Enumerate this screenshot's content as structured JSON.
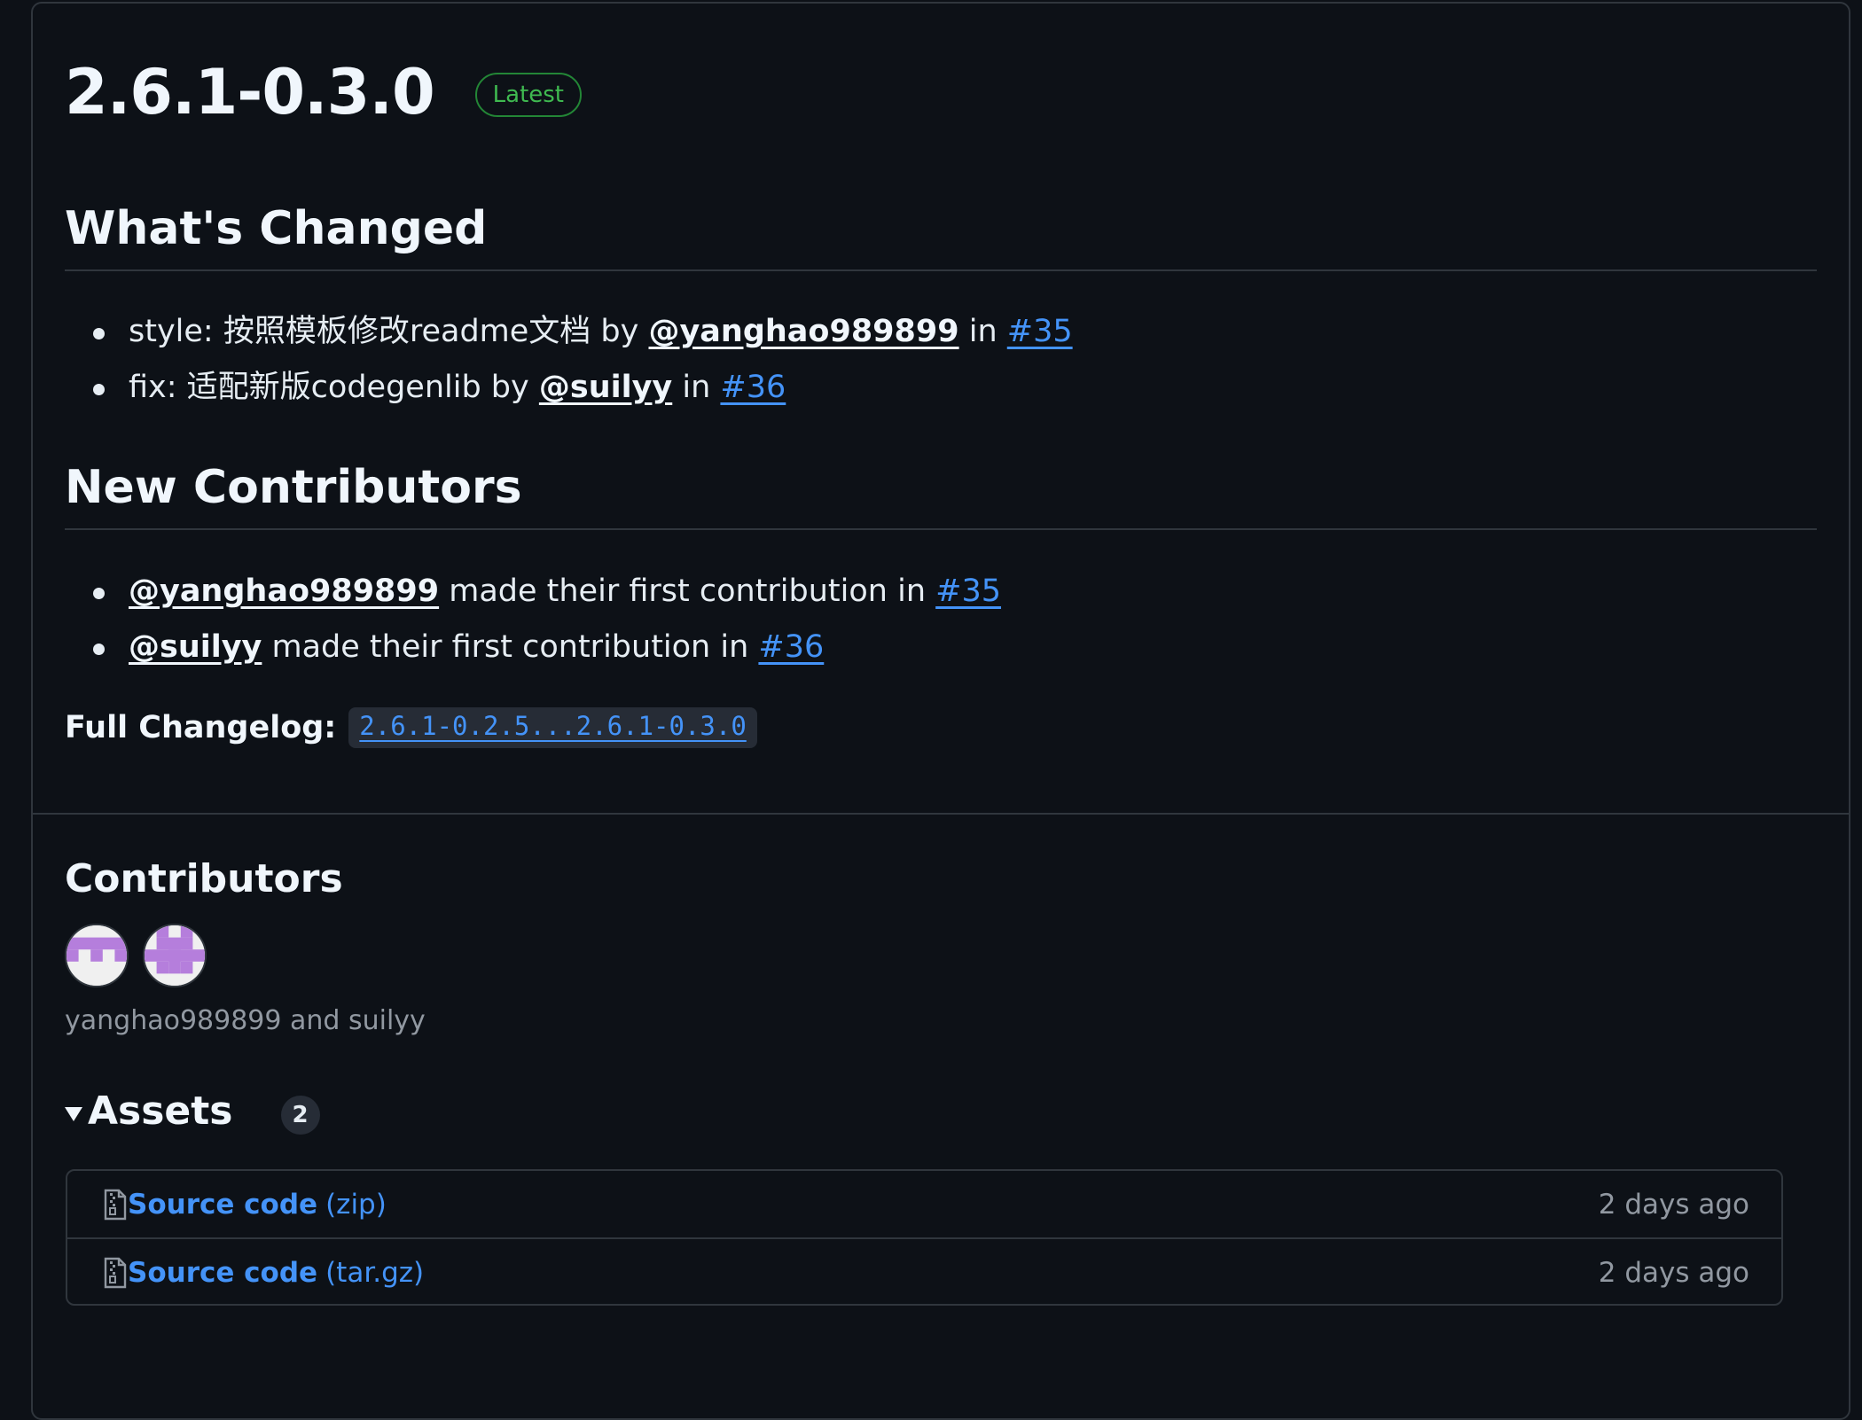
{
  "release": {
    "title": "2.6.1-0.3.0",
    "badge": "Latest"
  },
  "whats_changed": {
    "heading": "What's Changed",
    "items": [
      {
        "text": "style: 按照模板修改readme文档 by ",
        "author": "@yanghao989899",
        "in": " in ",
        "pr": "#35"
      },
      {
        "text": "fix: 适配新版codegenlib by ",
        "author": "@suilyy",
        "in": " in ",
        "pr": "#36"
      }
    ]
  },
  "new_contributors": {
    "heading": "New Contributors",
    "items": [
      {
        "author": "@yanghao989899",
        "text": " made their first contribution in ",
        "pr": "#35"
      },
      {
        "author": "@suilyy",
        "text": " made their first contribution in ",
        "pr": "#36"
      }
    ]
  },
  "changelog": {
    "label": "Full Changelog:",
    "link": "2.6.1-0.2.5...2.6.1-0.3.0"
  },
  "contributors": {
    "heading": "Contributors",
    "names": "yanghao989899 and suilyy",
    "avatar_color": "#b57edc"
  },
  "assets": {
    "title": "Assets",
    "count": "2",
    "items": [
      {
        "name": "Source code",
        "ext": "(zip)",
        "date": "2 days ago",
        "icon": "file-zip-icon"
      },
      {
        "name": "Source code",
        "ext": "(tar.gz)",
        "date": "2 days ago",
        "icon": "file-zip-icon"
      }
    ]
  },
  "colors": {
    "background": "#0d1117",
    "border": "#30363d",
    "link": "#4493f8",
    "latest": "#3fb950",
    "muted": "#9198a1"
  }
}
